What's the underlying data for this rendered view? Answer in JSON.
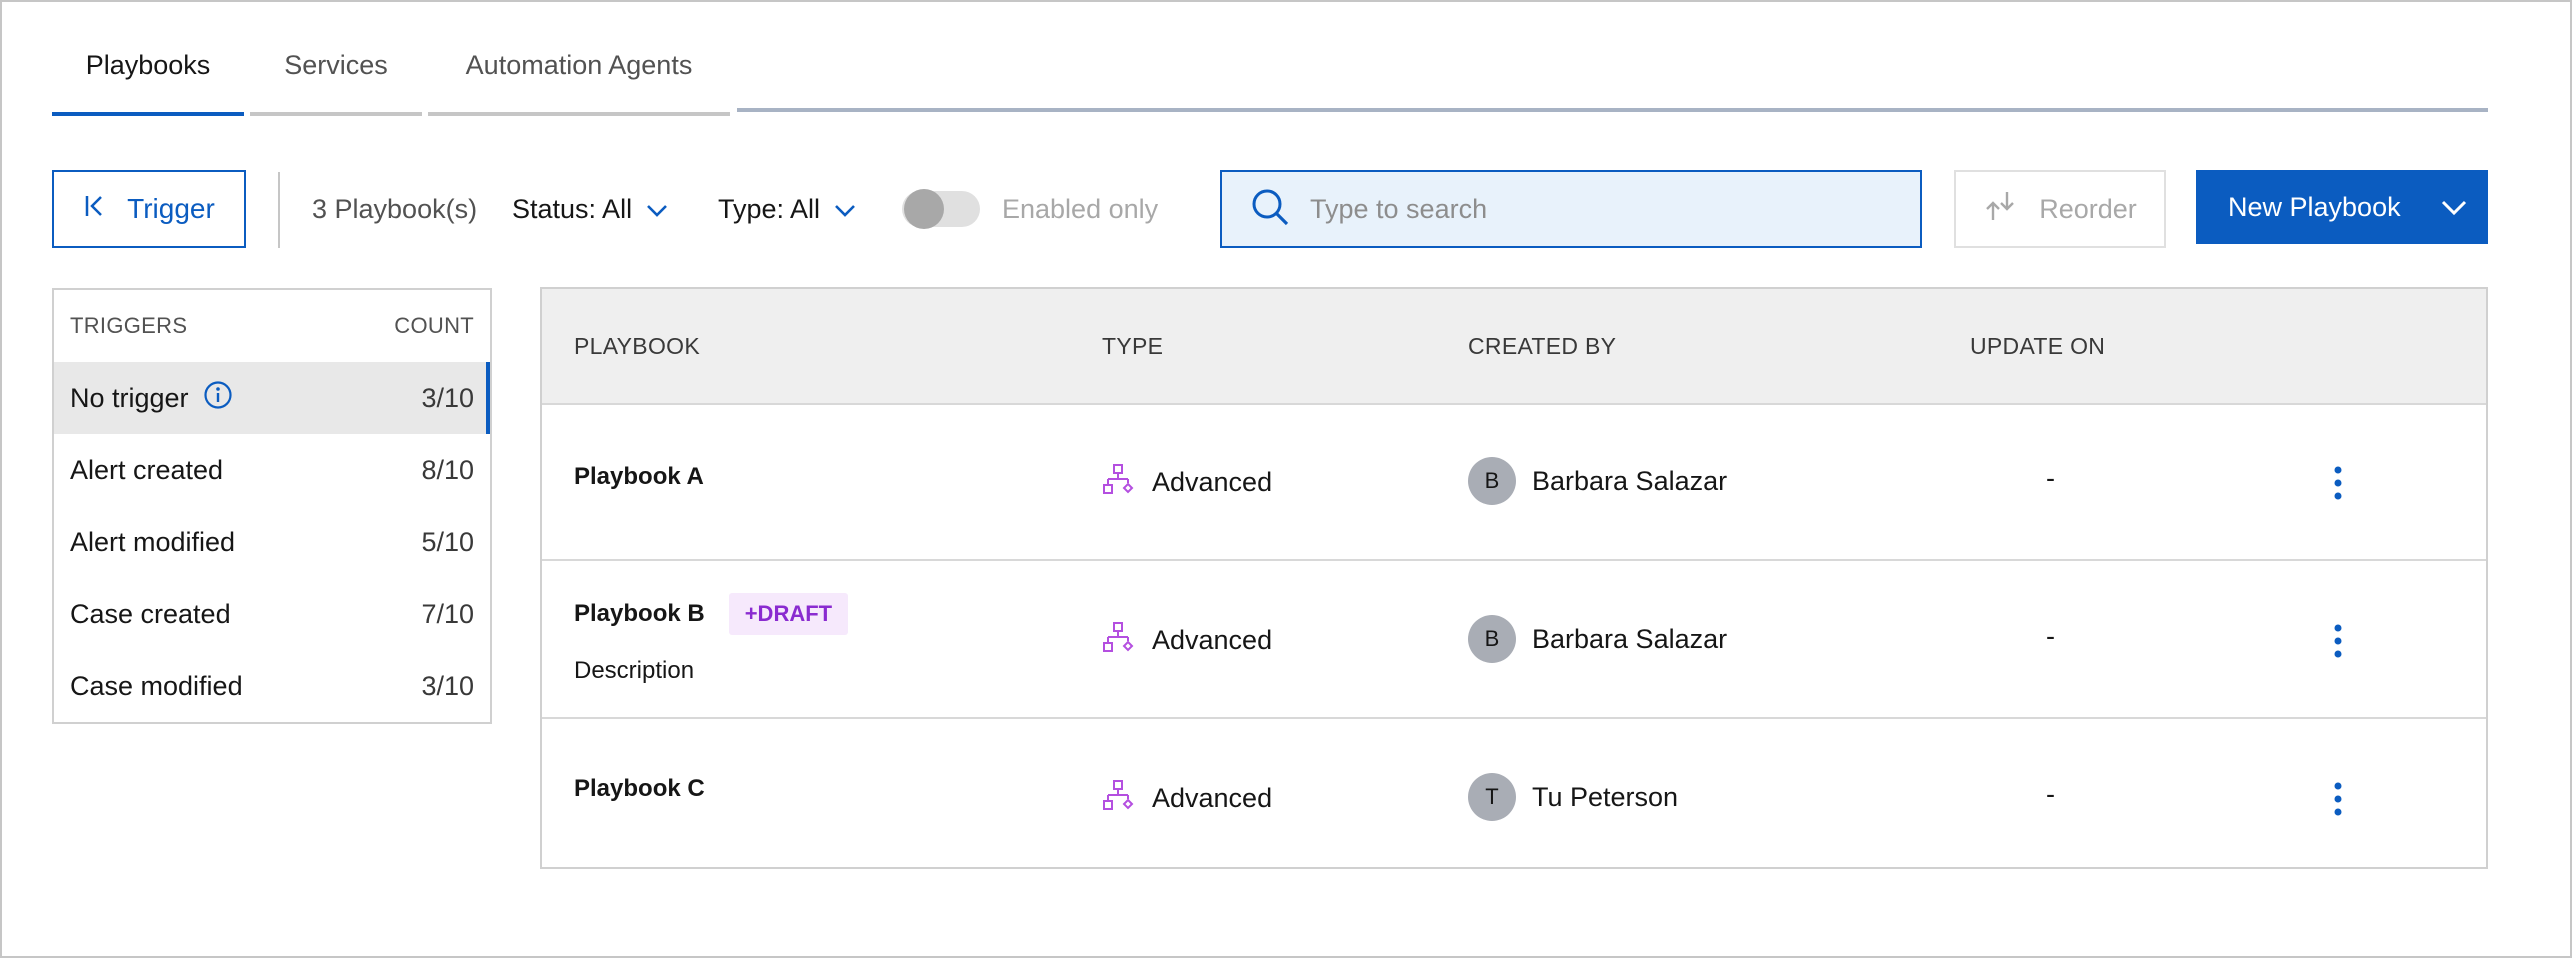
{
  "tabs": [
    {
      "label": "Playbooks",
      "active": true
    },
    {
      "label": "Services",
      "active": false
    },
    {
      "label": "Automation Agents",
      "active": false
    }
  ],
  "toolbar": {
    "trigger_button": "Trigger",
    "playbook_count": "3 Playbook(s)",
    "status_filter": "Status: All",
    "type_filter": "Type: All",
    "enabled_only_label": "Enabled only",
    "search_placeholder": "Type to search",
    "reorder_button": "Reorder",
    "new_playbook_button": "New Playbook"
  },
  "triggers_panel": {
    "header_name": "TRIGGERS",
    "header_count": "COUNT",
    "items": [
      {
        "label": "No trigger",
        "count": "3/10",
        "selected": true,
        "info_icon": true
      },
      {
        "label": "Alert created",
        "count": "8/10"
      },
      {
        "label": "Alert modified",
        "count": "5/10"
      },
      {
        "label": "Case created",
        "count": "7/10"
      },
      {
        "label": "Case modified",
        "count": "3/10"
      }
    ]
  },
  "table": {
    "columns": [
      "PLAYBOOK",
      "TYPE",
      "CREATED BY",
      "UPDATE ON"
    ],
    "rows": [
      {
        "name": "Playbook A",
        "badge": "",
        "description": "",
        "type": "Advanced",
        "creator_initial": "B",
        "creator": "Barbara Salazar",
        "updated": "-"
      },
      {
        "name": "Playbook B",
        "badge": "+DRAFT",
        "description": "Description",
        "type": "Advanced",
        "creator_initial": "B",
        "creator": "Barbara Salazar",
        "updated": "-"
      },
      {
        "name": "Playbook C",
        "badge": "",
        "description": "",
        "type": "Advanced",
        "creator_initial": "T",
        "creator": "Tu Peterson",
        "updated": "-"
      }
    ]
  },
  "colors": {
    "primary": "#0b5cc0",
    "draft_badge_bg": "#f6e9fc",
    "draft_badge_text": "#8a2bd0",
    "type_icon": "#b44fe0",
    "search_bg": "#e8f2fb"
  },
  "icons": {
    "trigger": "collapse-left-icon",
    "status_dropdown": "chevron-down-icon",
    "type_dropdown": "chevron-down-icon",
    "search": "search-icon",
    "reorder": "reorder-arrows-icon",
    "new_playbook": "chevron-down-icon",
    "info": "info-icon",
    "type": "workflow-icon",
    "row_menu": "overflow-menu-icon"
  }
}
